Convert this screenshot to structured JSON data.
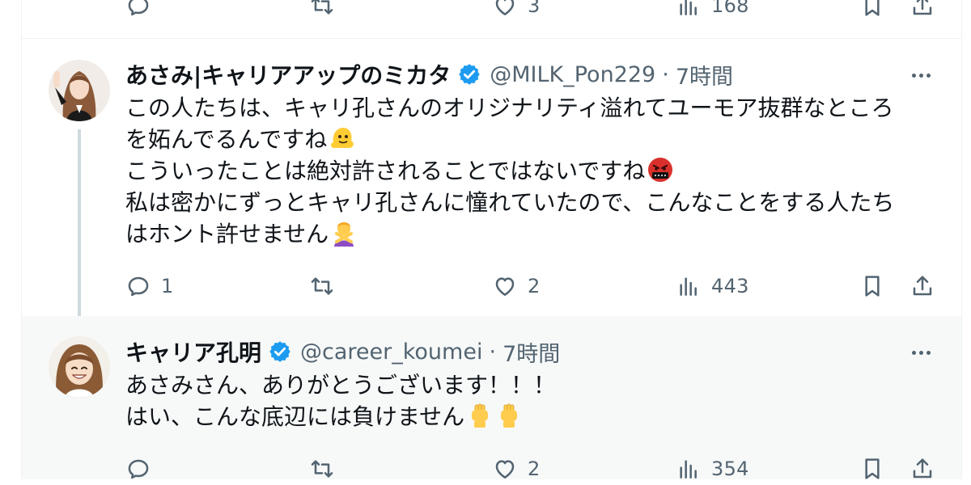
{
  "top_actions": {
    "reply_count": "",
    "retweet_count": "",
    "like_count": "3",
    "views_count": "168"
  },
  "tweet1": {
    "display_name": "あさみ|キャリアアップのミカタ",
    "handle": "@MILK_Pon229",
    "separator": "·",
    "time": "7時間",
    "lines": [
      "この人たちは、キャリ孔さんのオリジナリティ溢れてユーモア抜群なところ",
      "を妬んでるんですね",
      "こういったことは絶対許されることではないですね",
      "私は密かにずっとキャリ孔さんに憧れていたので、こんなことをする人たち",
      "はホント許せません"
    ],
    "reply_count": "1",
    "retweet_count": "",
    "like_count": "2",
    "views_count": "443"
  },
  "tweet2": {
    "display_name": "キャリア孔明",
    "handle": "@career_koumei",
    "separator": "·",
    "time": "7時間",
    "lines": [
      "あさみさん、ありがとうございます！！！",
      "はい、こんな底辺には負けません"
    ],
    "reply_count": "",
    "retweet_count": "",
    "like_count": "2",
    "views_count": "354"
  },
  "colors": {
    "text_primary": "#0f1419",
    "text_secondary": "#536471",
    "verified_blue": "#1d9bf0",
    "border": "#eff3f4",
    "thread_line": "#cfd9de",
    "highlight_bg": "#f7f9f9"
  },
  "icons": [
    "reply-icon",
    "retweet-icon",
    "like-icon",
    "views-icon",
    "bookmark-icon",
    "share-icon",
    "verified-badge-icon",
    "more-icon"
  ]
}
